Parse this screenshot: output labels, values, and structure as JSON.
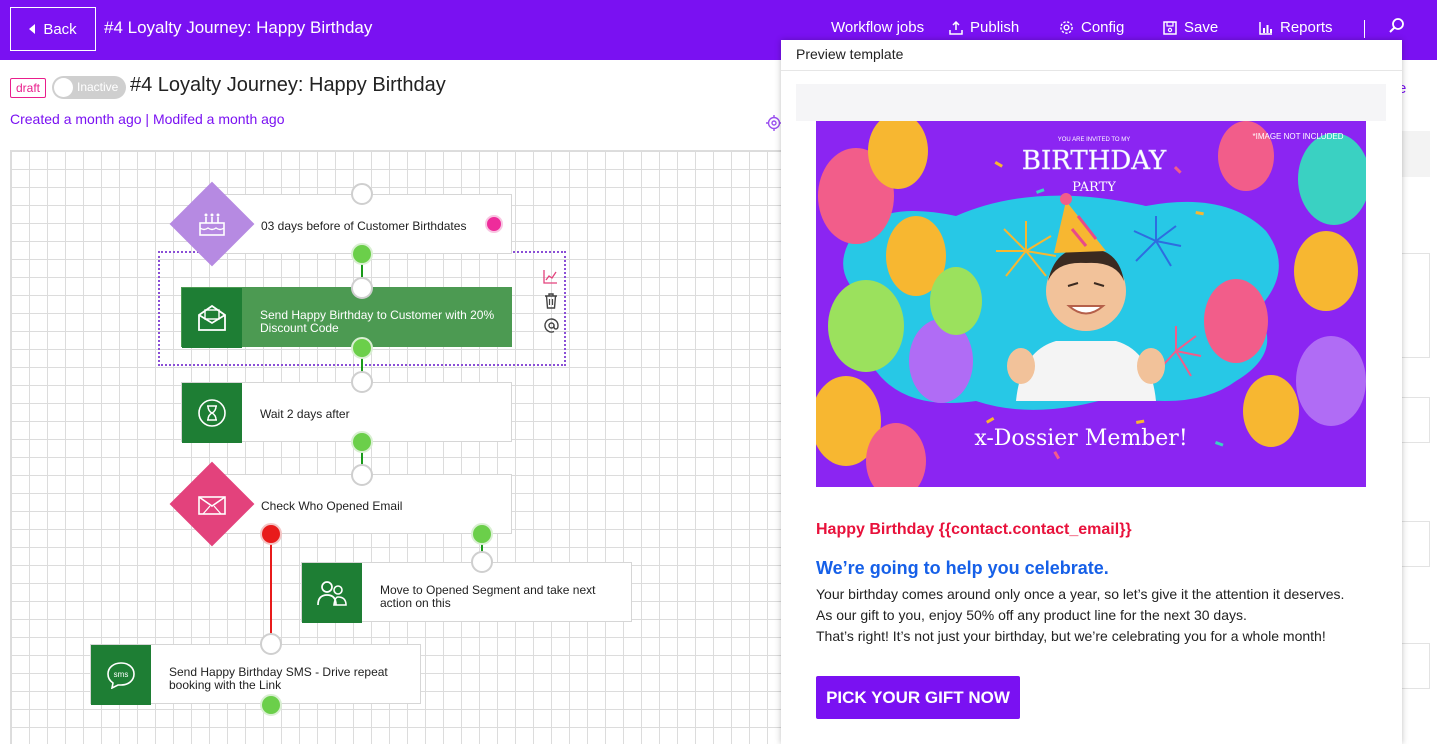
{
  "topbar": {
    "back_label": "Back",
    "title": "#4 Loyalty Journey: Happy Birthday",
    "nav": [
      {
        "label": "Workflow jobs",
        "icon": "none"
      },
      {
        "label": "Publish",
        "icon": "upload-icon"
      },
      {
        "label": "Config",
        "icon": "gear-icon"
      },
      {
        "label": "Save",
        "icon": "floppy-disk-icon"
      },
      {
        "label": "Reports",
        "icon": "bar-chart-icon"
      }
    ],
    "search_icon": "search-icon",
    "background_color": "#7a11f2"
  },
  "header": {
    "status_badge": "draft",
    "toggle_label": "Inactive",
    "title": "#4 Loyalty Journey: Happy Birthday",
    "created": "Created a month ago",
    "separator": " | ",
    "modified": "Modifed a month ago"
  },
  "workflow": {
    "trigger": {
      "label": "03 days before of Customer Birthdates",
      "icon": "birthday-cake-icon",
      "color": "#b68ae2"
    },
    "send_email": {
      "label": "Send Happy Birthday to Customer with 20% Discount Code",
      "icon": "envelope-open-icon"
    },
    "wait": {
      "label": "Wait 2 days after",
      "icon": "hourglass-icon"
    },
    "condition": {
      "label": "Check Who Opened Email",
      "icon": "envelope-icon",
      "color": "#e3427c"
    },
    "segment": {
      "label": "Move to Opened Segment and take next action on this",
      "icon": "users-icon"
    },
    "sms": {
      "label": "Send Happy Birthday SMS - Drive repeat booking with the Link",
      "icon": "sms-bubble-icon"
    },
    "colors": {
      "action": "#1e7e34",
      "selected": "#4c9a52",
      "yes_link": "#1a9a1a",
      "no_link": "#e81b1b"
    }
  },
  "side_tools": [
    "chart-icon",
    "trash-icon",
    "at-sign-icon"
  ],
  "underlay": {
    "link_fragment": "e"
  },
  "preview": {
    "title": "Preview template",
    "banner": {
      "invite_small": "YOU ARE INVITED TO MY",
      "birthday": "BIRTHDAY",
      "party": "PARTY",
      "note": "*IMAGE NOT INCLUDED",
      "member": "x-Dossier Member!"
    },
    "greeting": "Happy Birthday {{contact.contact_email}}",
    "headline": "We’re going to help you celebrate.",
    "body_lines": [
      "Your birthday comes around only once a year, so let’s give it the attention it deserves.",
      "As our gift to you, enjoy 50% off any product line for the next 30 days.",
      "That’s right! It’s not just your birthday, but we’re celebrating you for a whole month!"
    ],
    "cta": "PICK YOUR GIFT NOW",
    "colors": {
      "greeting": "#e8113b",
      "headline": "#1660e8",
      "cta": "#7a11f2"
    }
  }
}
